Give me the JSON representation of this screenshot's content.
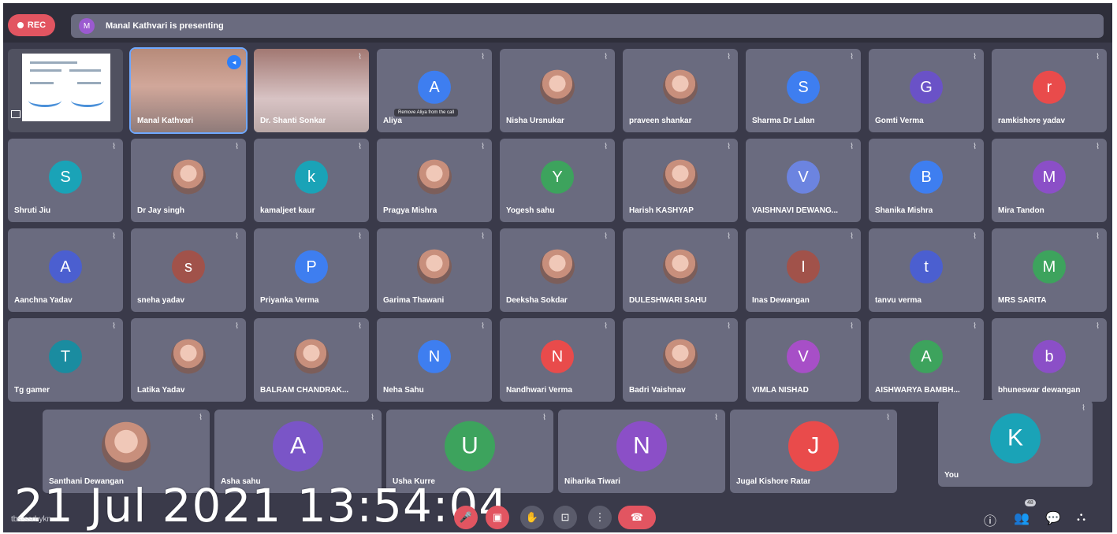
{
  "topbar": {
    "rec_label": "REC",
    "presenter_initial": "M",
    "presenting_text": "Manal Kathvari is presenting"
  },
  "grid": {
    "row1": [
      {
        "kind": "presentation"
      },
      {
        "kind": "video",
        "name": "Manal Kathvari",
        "speaking": true
      },
      {
        "kind": "video",
        "name": "Dr. Shanti Sonkar"
      },
      {
        "kind": "avatar",
        "initial": "A",
        "name": "Aliya",
        "color": "#3e7ef0",
        "tooltip": "Remove Aliya from the call"
      },
      {
        "kind": "photo",
        "name": "Nisha Ursnukar"
      },
      {
        "kind": "photo",
        "name": "praveen shankar"
      },
      {
        "kind": "avatar",
        "initial": "S",
        "name": "Sharma Dr Lalan",
        "color": "#3e7ef0"
      },
      {
        "kind": "avatar",
        "initial": "G",
        "name": "Gomti Verma",
        "color": "#6a52c7"
      },
      {
        "kind": "avatar",
        "initial": "r",
        "name": "ramkishore yadav",
        "color": "#e94b4b"
      }
    ],
    "row2": [
      {
        "kind": "avatar",
        "initial": "S",
        "name": "Shruti Jiu",
        "color": "#1aa3b7"
      },
      {
        "kind": "photo",
        "name": "Dr Jay singh"
      },
      {
        "kind": "avatar",
        "initial": "k",
        "name": "kamaljeet kaur",
        "color": "#1aa3b7"
      },
      {
        "kind": "photo",
        "name": "Pragya Mishra"
      },
      {
        "kind": "avatar",
        "initial": "Y",
        "name": "Yogesh sahu",
        "color": "#3da35d"
      },
      {
        "kind": "photo",
        "name": "Harish KASHYAP"
      },
      {
        "kind": "avatar",
        "initial": "V",
        "name": "VAISHNAVI DEWANG...",
        "color": "#6c84e0"
      },
      {
        "kind": "avatar",
        "initial": "B",
        "name": "Shanika Mishra",
        "color": "#3e7ef0"
      },
      {
        "kind": "avatar",
        "initial": "M",
        "name": "Mira Tandon",
        "color": "#8b4fc7"
      }
    ],
    "row3": [
      {
        "kind": "avatar",
        "initial": "A",
        "name": "Aanchna Yadav",
        "color": "#4b5fd0"
      },
      {
        "kind": "avatar",
        "initial": "s",
        "name": "sneha yadav",
        "color": "#a1524a"
      },
      {
        "kind": "avatar",
        "initial": "P",
        "name": "Priyanka Verma",
        "color": "#3e7ef0"
      },
      {
        "kind": "photo",
        "name": "Garima Thawani"
      },
      {
        "kind": "photo",
        "name": "Deeksha Sokdar"
      },
      {
        "kind": "photo",
        "name": "DULESHWARI SAHU"
      },
      {
        "kind": "avatar",
        "initial": "I",
        "name": "Inas Dewangan",
        "color": "#a1524a"
      },
      {
        "kind": "avatar",
        "initial": "t",
        "name": "tanvu verma",
        "color": "#4b5fd0"
      },
      {
        "kind": "avatar",
        "initial": "M",
        "name": "MRS SARITA",
        "color": "#3da35d"
      }
    ],
    "row4": [
      {
        "kind": "avatar",
        "initial": "T",
        "name": "Tg gamer",
        "color": "#1a8ca0"
      },
      {
        "kind": "photo",
        "name": "Latika Yadav"
      },
      {
        "kind": "photo",
        "name": "BALRAM CHANDRAK..."
      },
      {
        "kind": "avatar",
        "initial": "N",
        "name": "Neha Sahu",
        "color": "#3e7ef0"
      },
      {
        "kind": "avatar",
        "initial": "N",
        "name": "Nandhwari Verma",
        "color": "#e94b4b"
      },
      {
        "kind": "photo",
        "name": "Badri Vaishnav"
      },
      {
        "kind": "avatar",
        "initial": "V",
        "name": "VIMLA NISHAD",
        "color": "#a74fc7"
      },
      {
        "kind": "avatar",
        "initial": "A",
        "name": "AISHWARYA BAMBH...",
        "color": "#3da35d"
      },
      {
        "kind": "avatar",
        "initial": "b",
        "name": "bhuneswar dewangan",
        "color": "#8b4fc7"
      }
    ],
    "row5": [
      {
        "kind": "photo",
        "name": "Santhani Dewangan"
      },
      {
        "kind": "avatar",
        "initial": "A",
        "name": "Asha sahu",
        "color": "#7a55c7"
      },
      {
        "kind": "avatar",
        "initial": "U",
        "name": "Usha Kurre",
        "color": "#3da35d"
      },
      {
        "kind": "avatar",
        "initial": "N",
        "name": "Niharika Tiwari",
        "color": "#8b4fc7"
      },
      {
        "kind": "avatar",
        "initial": "J",
        "name": "Jugal Kishore Ratar",
        "color": "#e94b4b"
      },
      {
        "kind": "avatar",
        "initial": "K",
        "name": "You",
        "color": "#1aa3b7"
      }
    ]
  },
  "overlay": {
    "timestamp": "21 Jul 2021 13:54:04",
    "meeting_code": "tbs-ssd-ykn"
  },
  "controls": {
    "participants_count": "48",
    "mic_icon": "mic-off-icon",
    "camera_icon": "camera-off-icon",
    "hand_icon": "raise-hand-icon",
    "present_icon": "present-screen-icon",
    "more_icon": "more-options-icon",
    "hangup_icon": "hang-up-icon",
    "info_icon": "info-icon",
    "people_icon": "people-icon",
    "chat_icon": "chat-icon",
    "activities_icon": "activities-icon"
  }
}
